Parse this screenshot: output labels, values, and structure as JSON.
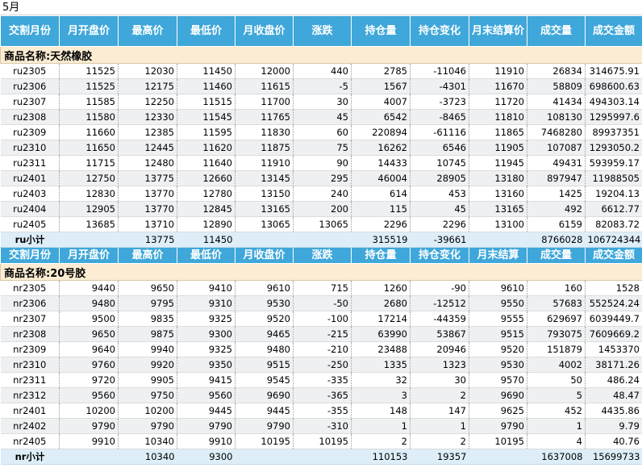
{
  "sheet_title": "5月",
  "header_top": [
    "交割月份",
    "月开盘价",
    "最高价",
    "最低价",
    "月收盘价",
    "涨跌",
    "持仓量",
    "持仓变化",
    "月末结算价",
    "成交量",
    "成交金额"
  ],
  "header_mid": [
    "交割月份",
    "月开盘价",
    "最高价",
    "最低价",
    "月收盘价",
    "涨跌",
    "持仓量",
    "持仓变化",
    "月末结算",
    "成交量",
    "成交金额"
  ],
  "section1": {
    "title": "商品名称:天然橡胶",
    "rows": [
      [
        "ru2305",
        "11525",
        "12030",
        "11450",
        "12000",
        "440",
        "2785",
        "-11046",
        "11910",
        "26834",
        "314675.91"
      ],
      [
        "ru2306",
        "11525",
        "12175",
        "11460",
        "11615",
        "-5",
        "1567",
        "-4301",
        "11670",
        "58809",
        "698600.63"
      ],
      [
        "ru2307",
        "11585",
        "12250",
        "11515",
        "11700",
        "30",
        "4007",
        "-3723",
        "11720",
        "41434",
        "494303.14"
      ],
      [
        "ru2308",
        "11580",
        "12330",
        "11545",
        "11765",
        "45",
        "6542",
        "-8465",
        "11810",
        "108130",
        "1295997.6"
      ],
      [
        "ru2309",
        "11660",
        "12385",
        "11595",
        "11830",
        "60",
        "220894",
        "-61116",
        "11865",
        "7468280",
        "89937351"
      ],
      [
        "ru2310",
        "11650",
        "12445",
        "11620",
        "11875",
        "75",
        "16262",
        "6546",
        "11905",
        "107087",
        "1293050.2"
      ],
      [
        "ru2311",
        "11715",
        "12480",
        "11640",
        "11910",
        "90",
        "14433",
        "10745",
        "11945",
        "49431",
        "593959.17"
      ],
      [
        "ru2401",
        "12750",
        "13775",
        "12660",
        "13145",
        "295",
        "46004",
        "28905",
        "13180",
        "897947",
        "11988505"
      ],
      [
        "ru2403",
        "12830",
        "13770",
        "12780",
        "13150",
        "240",
        "614",
        "453",
        "13160",
        "1425",
        "19204.13"
      ],
      [
        "ru2404",
        "12905",
        "13770",
        "12845",
        "13165",
        "200",
        "115",
        "45",
        "13165",
        "492",
        "6612.77"
      ],
      [
        "ru2405",
        "13685",
        "13710",
        "12890",
        "13065",
        "13065",
        "2296",
        "2296",
        "13100",
        "6159",
        "82083.72"
      ]
    ],
    "subtotal": [
      "ru小计",
      "",
      "13775",
      "11450",
      "",
      "",
      "315519",
      "-39661",
      "",
      "8766028",
      "106724344"
    ]
  },
  "section2": {
    "title": "商品名称:20号胶",
    "rows": [
      [
        "nr2305",
        "9440",
        "9650",
        "9410",
        "9610",
        "715",
        "1260",
        "-90",
        "9610",
        "160",
        "1528"
      ],
      [
        "nr2306",
        "9480",
        "9795",
        "9310",
        "9530",
        "-50",
        "2680",
        "-12512",
        "9550",
        "57683",
        "552524.24"
      ],
      [
        "nr2307",
        "9500",
        "9835",
        "9325",
        "9520",
        "-100",
        "17214",
        "-44359",
        "9555",
        "629697",
        "6039449.7"
      ],
      [
        "nr2308",
        "9650",
        "9875",
        "9300",
        "9465",
        "-215",
        "63990",
        "53867",
        "9515",
        "793075",
        "7609669.2"
      ],
      [
        "nr2309",
        "9640",
        "9940",
        "9325",
        "9480",
        "-210",
        "23488",
        "20946",
        "9520",
        "151879",
        "1453370"
      ],
      [
        "nr2310",
        "9760",
        "9920",
        "9350",
        "9515",
        "-250",
        "1335",
        "1323",
        "9530",
        "4002",
        "38171.26"
      ],
      [
        "nr2311",
        "9720",
        "9905",
        "9415",
        "9545",
        "-335",
        "32",
        "30",
        "9570",
        "50",
        "486.24"
      ],
      [
        "nr2312",
        "9560",
        "9750",
        "9560",
        "9690",
        "-365",
        "3",
        "2",
        "9690",
        "5",
        "48.47"
      ],
      [
        "nr2401",
        "10200",
        "10200",
        "9445",
        "9445",
        "-355",
        "148",
        "147",
        "9625",
        "452",
        "4435.86"
      ],
      [
        "nr2402",
        "9790",
        "9790",
        "9790",
        "9790",
        "-310",
        "1",
        "1",
        "9790",
        "1",
        "9.79"
      ],
      [
        "nr2405",
        "9910",
        "10340",
        "9910",
        "10195",
        "10195",
        "2",
        "2",
        "10195",
        "4",
        "40.76"
      ]
    ],
    "subtotal": [
      "nr小计",
      "",
      "10340",
      "9300",
      "",
      "",
      "110153",
      "19357",
      "",
      "1637008",
      "15699733"
    ]
  }
}
